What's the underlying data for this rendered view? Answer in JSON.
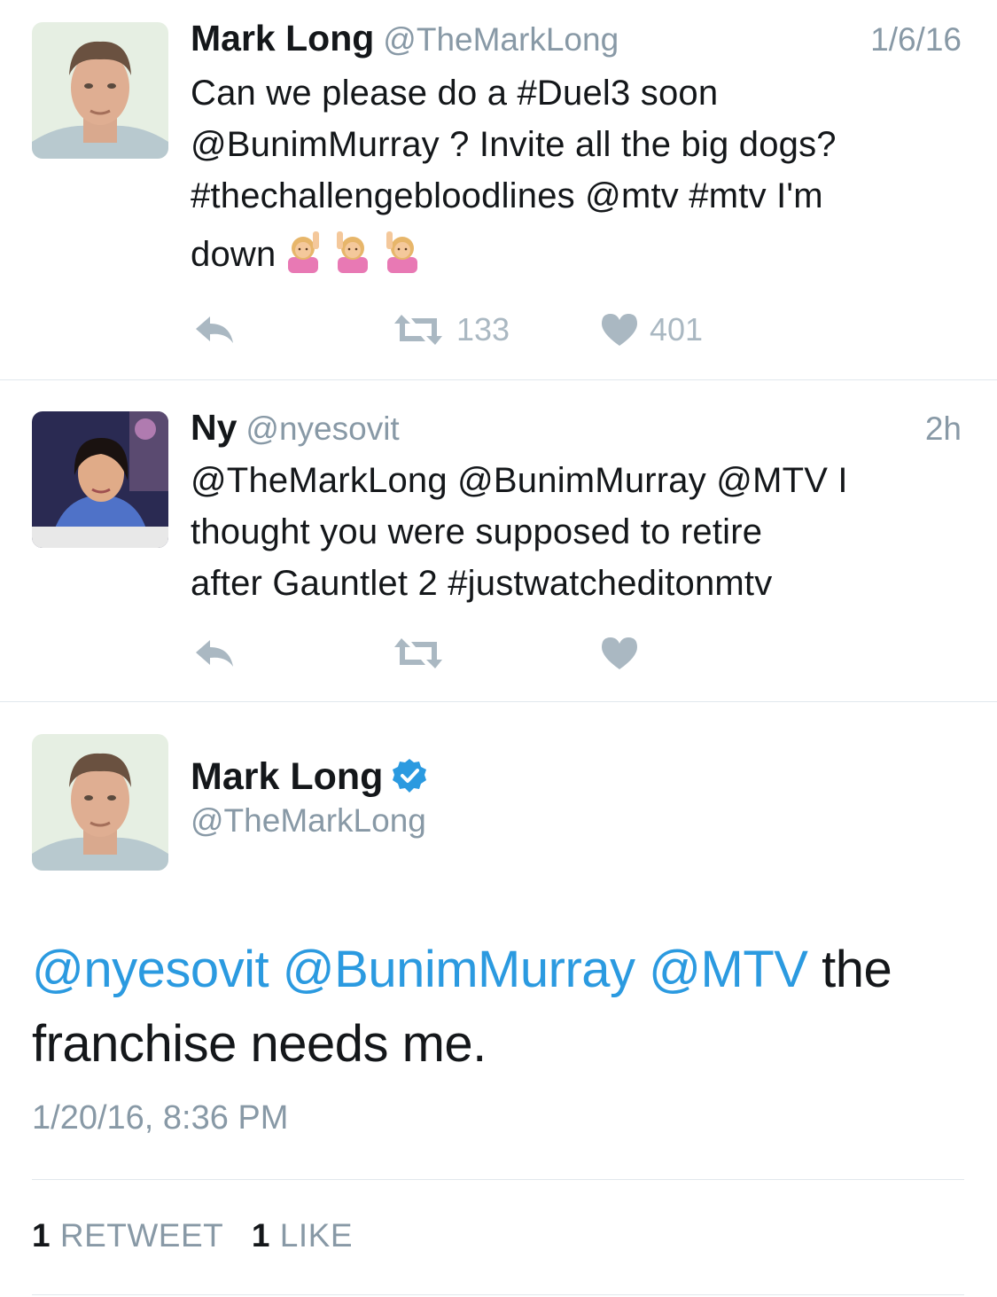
{
  "tweets": [
    {
      "name": "Mark Long",
      "handle": "@TheMarkLong",
      "time": "1/6/16",
      "text_lines": [
        "Can we please do a #Duel3 soon",
        "@BunimMurray ? Invite all the big dogs?",
        "#thechallengebloodlines @mtv #mtv I'm",
        "down"
      ],
      "emoji": "raising-hand-emoji",
      "retweets": "133",
      "likes": "401"
    },
    {
      "name": "Ny",
      "handle": "@nyesovit",
      "time": "2h",
      "text_lines": [
        "@TheMarkLong @BunimMurray @MTV I",
        "thought you were supposed to retire",
        "after Gauntlet 2 #justwatcheditonmtv"
      ]
    }
  ],
  "focused": {
    "name": "Mark Long",
    "handle": "@TheMarkLong",
    "mentions": [
      "@nyesovit",
      "@BunimMurray",
      "@MTV"
    ],
    "text_after_mentions": "the",
    "text_line2": "franchise needs me.",
    "timestamp": "1/20/16, 8:36 PM",
    "retweet_count": "1",
    "retweet_label": "RETWEET",
    "like_count": "1",
    "like_label": "LIKE"
  },
  "colors": {
    "link": "#2b9ae0",
    "muted": "#8899a6",
    "icon": "#aab8c2",
    "text": "#14171a",
    "divider": "#e1e8ed"
  }
}
